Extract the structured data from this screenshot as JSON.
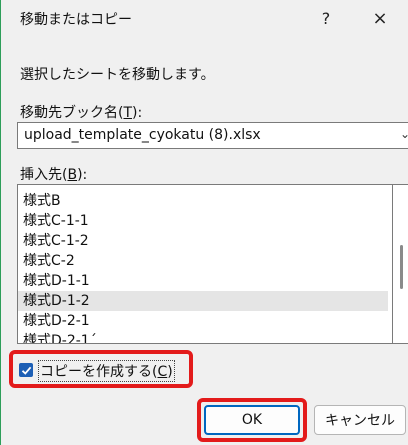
{
  "dialog": {
    "title": "移動またはコピー",
    "help_label": "?",
    "close_label": "×"
  },
  "message": "選択したシートを移動します。",
  "book_field": {
    "label_prefix": "移動先ブック名(",
    "label_key": "T",
    "label_suffix": "):",
    "value": "upload_template_cyokatu (8).xlsx"
  },
  "insert_field": {
    "label_prefix": "挿入先(",
    "label_key": "B",
    "label_suffix": "):",
    "items": [
      "様式B",
      "様式C-1-1",
      "様式C-1-2",
      "様式C-2",
      "様式D-1-1",
      "様式D-1-2",
      "様式D-2-1",
      "様式D-2-1´"
    ],
    "selected": "様式D-1-2"
  },
  "copy_checkbox": {
    "label_prefix": "コピーを作成する(",
    "label_key": "C",
    "label_suffix": ")",
    "checked": true
  },
  "buttons": {
    "ok": "OK",
    "cancel": "キャンセル"
  },
  "colors": {
    "accent": "#0067c0",
    "highlight": "#e31b1b",
    "checkbox": "#1d5fb5"
  }
}
